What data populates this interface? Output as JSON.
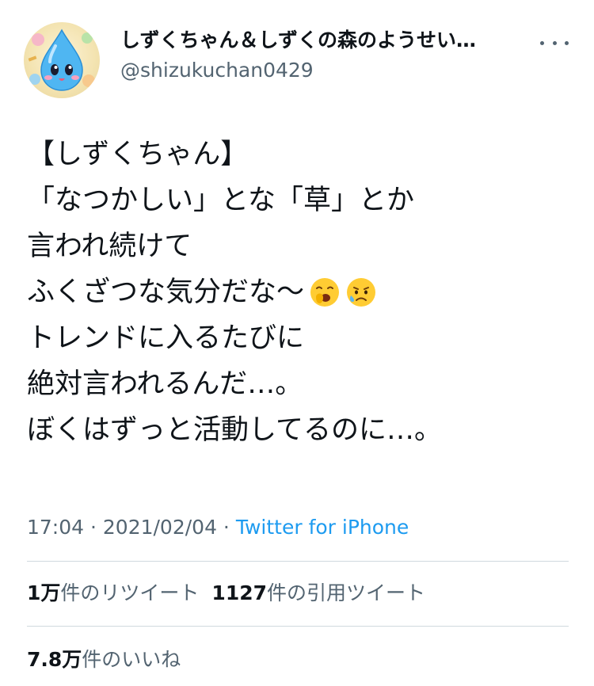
{
  "author": {
    "display_name": "しずくちゃん＆しずくの森のようせい…",
    "handle": "@shizukuchan0429"
  },
  "tweet": {
    "lines": [
      "【しずくちゃん】",
      "「なつかしい」とな「草」とか",
      "言われ続けて",
      "ふくざつな気分だな〜",
      "トレンドに入るたびに",
      "絶対言われるんだ…。",
      "ぼくはずっと活動してるのに…。"
    ],
    "emojis": [
      "yawning-face-emoji",
      "anxious-face-with-sweat-emoji"
    ]
  },
  "meta": {
    "time": "17:04",
    "separator": " · ",
    "date": "2021/02/04",
    "source": "Twitter for iPhone"
  },
  "stats": {
    "retweets_count": "1万",
    "retweets_label": "件のリツイート",
    "quotes_count": "1127",
    "quotes_label": "件の引用ツイート",
    "likes_count": "7.8万",
    "likes_label": "件のいいね"
  },
  "colors": {
    "text": "#0f1419",
    "muted": "#536471",
    "link": "#1d9bf0",
    "divider": "#cfd9de"
  }
}
